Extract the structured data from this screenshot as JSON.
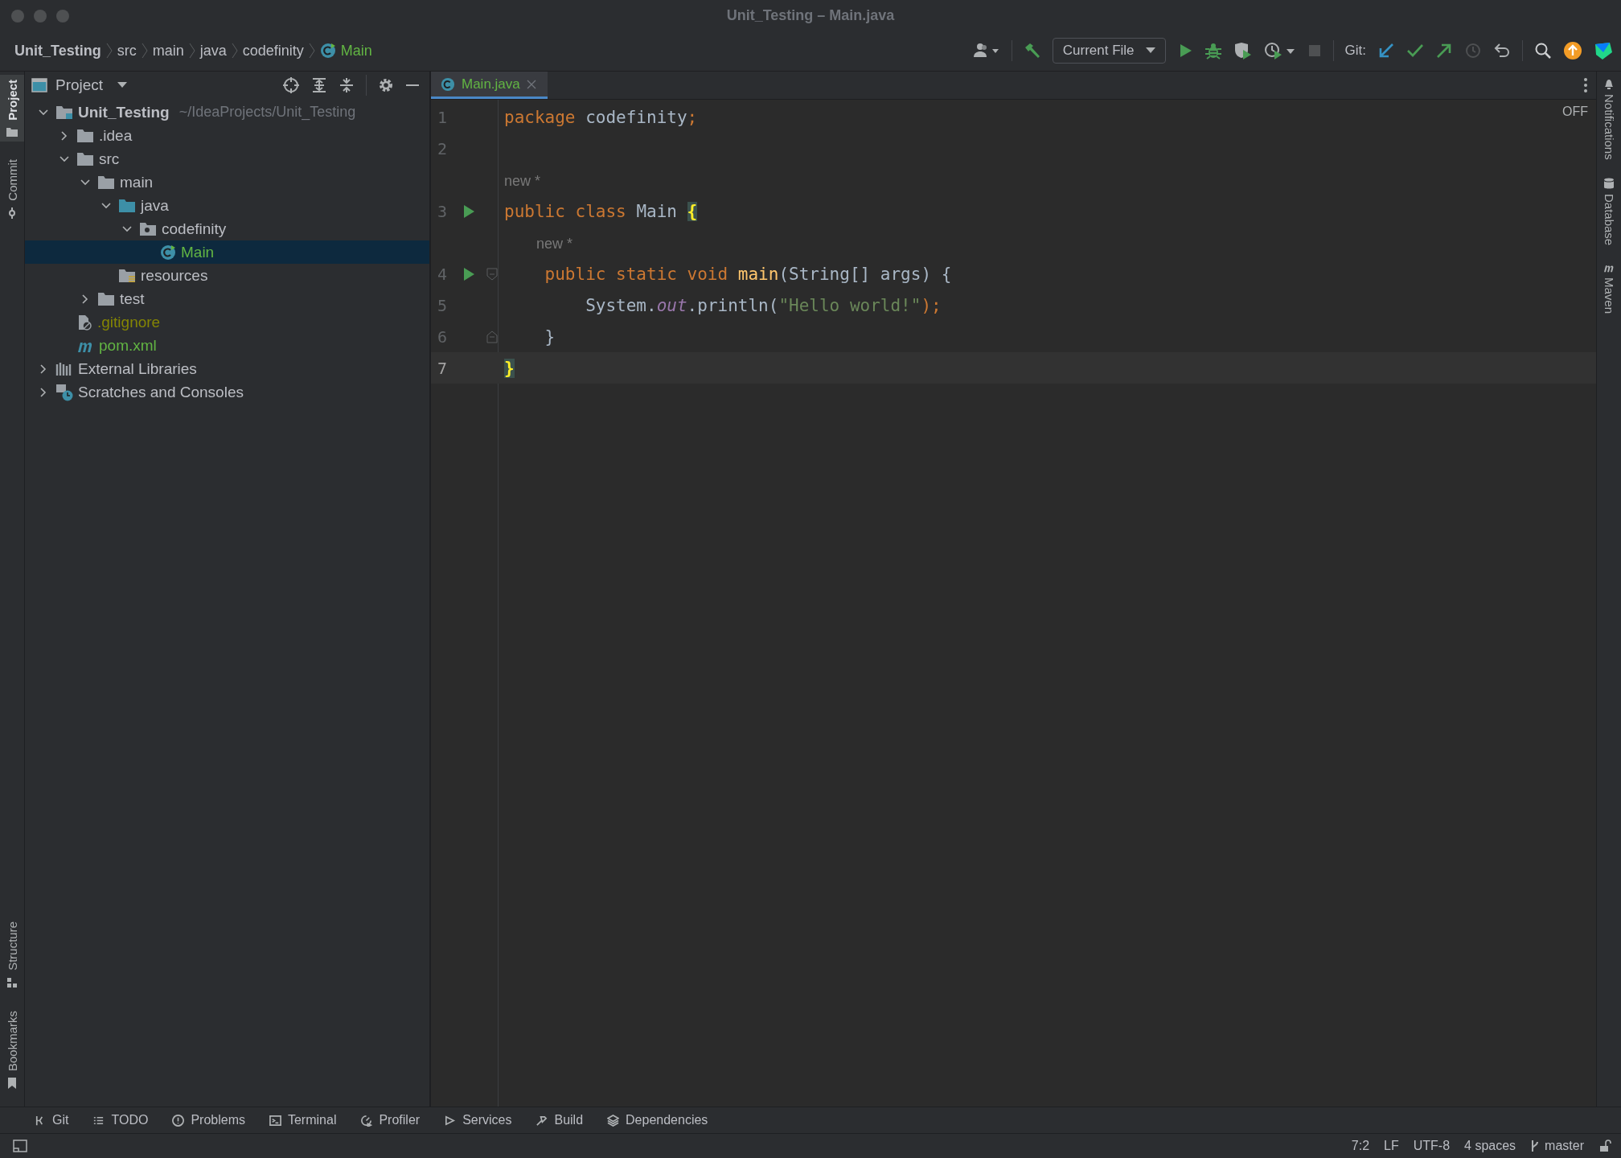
{
  "window": {
    "title": "Unit_Testing – Main.java"
  },
  "breadcrumbs": [
    {
      "label": "Unit_Testing",
      "kind": "project"
    },
    {
      "label": "src",
      "kind": "dir"
    },
    {
      "label": "main",
      "kind": "dir"
    },
    {
      "label": "java",
      "kind": "dir"
    },
    {
      "label": "codefinity",
      "kind": "dir"
    },
    {
      "label": "Main",
      "kind": "class"
    }
  ],
  "toolbar": {
    "run_config": "Current File",
    "git_label": "Git:"
  },
  "left_strip": {
    "top": [
      {
        "label": "Project",
        "selected": true
      },
      {
        "label": "Commit",
        "selected": false
      }
    ],
    "bottom": [
      {
        "label": "Structure",
        "selected": false
      },
      {
        "label": "Bookmarks",
        "selected": false
      }
    ]
  },
  "project_panel": {
    "title": "Project",
    "tree": [
      {
        "label": "Unit_Testing",
        "kind": "project",
        "hint": "~/IdeaProjects/Unit_Testing",
        "expanded": true,
        "selected": false,
        "children": [
          {
            "label": ".idea",
            "kind": "folder",
            "expanded": false,
            "selected": false
          },
          {
            "label": "src",
            "kind": "folder",
            "expanded": true,
            "selected": false,
            "children": [
              {
                "label": "main",
                "kind": "folder",
                "expanded": true,
                "selected": false,
                "children": [
                  {
                    "label": "java",
                    "kind": "source-folder",
                    "expanded": true,
                    "selected": false,
                    "children": [
                      {
                        "label": "codefinity",
                        "kind": "package",
                        "expanded": true,
                        "selected": false,
                        "children": [
                          {
                            "label": "Main",
                            "kind": "class",
                            "color": "#62b543",
                            "selected": true
                          }
                        ]
                      }
                    ]
                  },
                  {
                    "label": "resources",
                    "kind": "resources",
                    "selected": false
                  }
                ]
              },
              {
                "label": "test",
                "kind": "folder",
                "expanded": false,
                "selected": false
              }
            ]
          },
          {
            "label": ".gitignore",
            "kind": "gitignore",
            "color": "#848504",
            "selected": false
          },
          {
            "label": "pom.xml",
            "kind": "maven",
            "color": "#62b543",
            "selected": false
          }
        ]
      },
      {
        "label": "External Libraries",
        "kind": "libraries",
        "expanded": false,
        "selected": false
      },
      {
        "label": "Scratches and Consoles",
        "kind": "scratches",
        "expanded": false,
        "selected": false
      }
    ]
  },
  "editor": {
    "tabs": [
      {
        "label": "Main.java",
        "selected": true
      }
    ],
    "inspection": "OFF",
    "lines": [
      {
        "number": "1",
        "run": false,
        "current": false,
        "tokens": [
          {
            "text": "package ",
            "kind": "keyword"
          },
          {
            "text": "codefinity",
            "kind": "plain"
          },
          {
            "text": ";",
            "kind": "keyword"
          }
        ]
      },
      {
        "number": "2",
        "run": false,
        "current": false
      },
      {
        "kind": "inlay",
        "text": "new *"
      },
      {
        "number": "3",
        "run": true,
        "current": false,
        "tokens": [
          {
            "text": "public class ",
            "kind": "keyword"
          },
          {
            "text": "Main ",
            "kind": "plain"
          },
          {
            "text": "{",
            "kind": "brace-match"
          }
        ]
      },
      {
        "kind": "inlay",
        "text": "new *"
      },
      {
        "number": "4",
        "run": true,
        "fold_start": true,
        "current": false,
        "tokens": [
          {
            "text": "    public static void ",
            "kind": "keyword"
          },
          {
            "text": "main",
            "kind": "method"
          },
          {
            "text": "(String[] args) {",
            "kind": "plain"
          }
        ]
      },
      {
        "number": "5",
        "run": false,
        "current": false,
        "tokens": [
          {
            "text": "        System.",
            "kind": "plain"
          },
          {
            "text": "out",
            "kind": "static-field"
          },
          {
            "text": ".println(",
            "kind": "plain"
          },
          {
            "text": "\"Hello world!\"",
            "kind": "string"
          },
          {
            "text": ");",
            "kind": "keyword"
          }
        ]
      },
      {
        "number": "6",
        "run": false,
        "fold_end": true,
        "current": false,
        "tokens": [
          {
            "text": "    }",
            "kind": "plain"
          }
        ]
      },
      {
        "number": "7",
        "run": false,
        "current": true,
        "tokens": [
          {
            "text": "}",
            "kind": "brace-match"
          }
        ]
      }
    ]
  },
  "right_strip": [
    {
      "label": "Notifications",
      "selected": false
    },
    {
      "label": "Database",
      "selected": false
    },
    {
      "label": "Maven",
      "selected": false
    }
  ],
  "tool_windows": [
    {
      "label": "Git"
    },
    {
      "label": "TODO"
    },
    {
      "label": "Problems"
    },
    {
      "label": "Terminal"
    },
    {
      "label": "Profiler"
    },
    {
      "label": "Services"
    },
    {
      "label": "Build"
    },
    {
      "label": "Dependencies"
    }
  ],
  "status": {
    "position": "7:2",
    "line_ending": "LF",
    "encoding": "UTF-8",
    "indent": "4 spaces",
    "branch": "master"
  }
}
